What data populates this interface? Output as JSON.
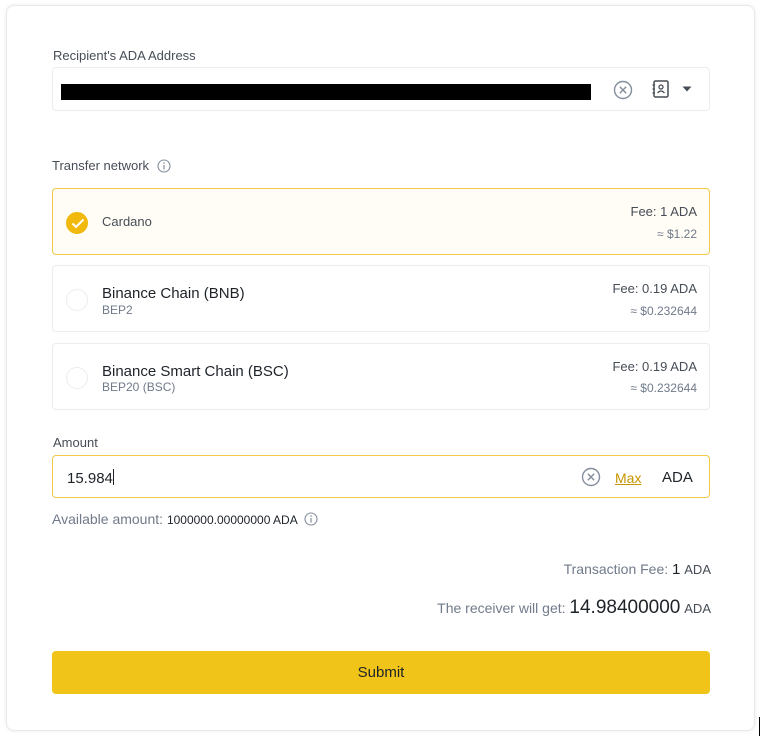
{
  "recipient": {
    "label": "Recipient's ADA Address",
    "icons": [
      "clear-circle-icon",
      "address-book-icon",
      "chevron-down-icon"
    ]
  },
  "network": {
    "label": "Transfer network",
    "options": [
      {
        "name": "Cardano",
        "sub": "",
        "fee": "Fee: 1 ADA",
        "approx": "≈ $1.22",
        "selected": true
      },
      {
        "name": "Binance Chain (BNB)",
        "sub": "BEP2",
        "fee": "Fee: 0.19 ADA",
        "approx": "≈ $0.232644",
        "selected": false
      },
      {
        "name": "Binance Smart Chain (BSC)",
        "sub": "BEP20 (BSC)",
        "fee": "Fee: 0.19 ADA",
        "approx": "≈ $0.232644",
        "selected": false
      }
    ]
  },
  "amount": {
    "label": "Amount",
    "value": "15.984",
    "max_label": "Max",
    "unit": "ADA",
    "available_label": "Available amount:",
    "available_value": "1000000.00000000 ADA"
  },
  "summary": {
    "fee_label": "Transaction Fee:",
    "fee_value": "1",
    "fee_unit": "ADA",
    "receive_label": "The receiver will get:",
    "receive_value": "14.98400000",
    "receive_unit": "ADA"
  },
  "submit_label": "Submit",
  "colors": {
    "accent": "#f0b90b",
    "button": "#f0c419",
    "link": "#c99400"
  }
}
